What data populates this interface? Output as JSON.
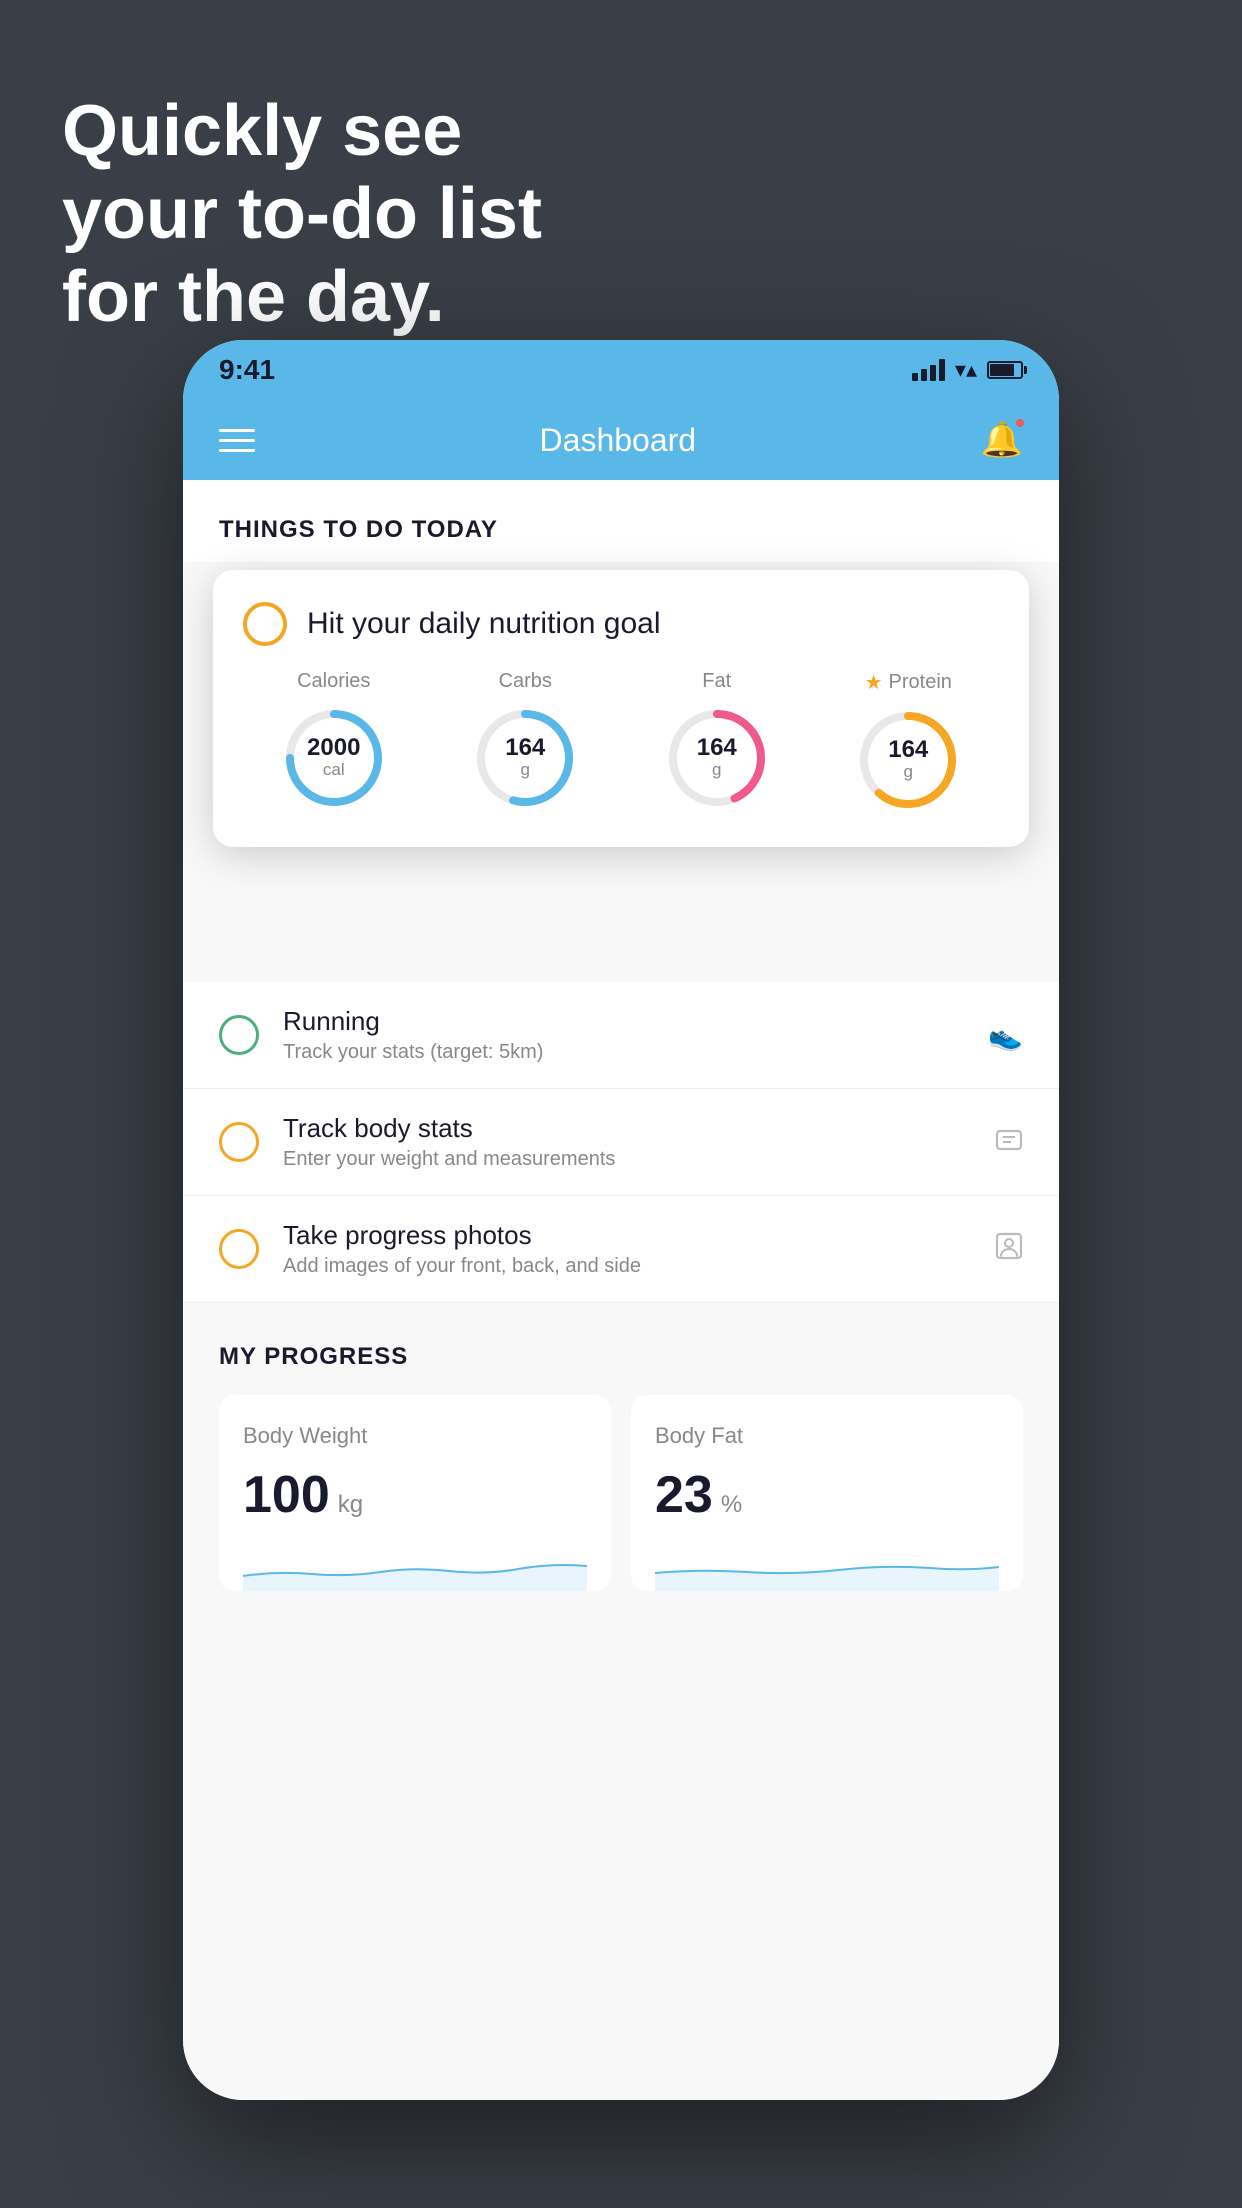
{
  "background": {
    "headline_line1": "Quickly see",
    "headline_line2": "your to-do list",
    "headline_line3": "for the day.",
    "bg_color": "#3a3f47"
  },
  "phone": {
    "status_bar": {
      "time": "9:41",
      "signal_bars": 4,
      "wifi": true,
      "battery_percent": 80
    },
    "nav_bar": {
      "title": "Dashboard",
      "menu_icon": "hamburger",
      "notification_icon": "bell",
      "has_notification": true
    },
    "things_to_do": {
      "section_title": "THINGS TO DO TODAY",
      "nutrition_card": {
        "title": "Hit your daily nutrition goal",
        "stats": [
          {
            "label": "Calories",
            "value": "2000",
            "unit": "cal",
            "color": "#5ab8e8",
            "starred": false
          },
          {
            "label": "Carbs",
            "value": "164",
            "unit": "g",
            "color": "#5ab8e8",
            "starred": false
          },
          {
            "label": "Fat",
            "value": "164",
            "unit": "g",
            "color": "#f05a8a",
            "starred": false
          },
          {
            "label": "Protein",
            "value": "164",
            "unit": "g",
            "color": "#f5a623",
            "starred": true
          }
        ]
      },
      "todo_items": [
        {
          "title": "Running",
          "subtitle": "Track your stats (target: 5km)",
          "circle_color": "green",
          "icon": "shoe"
        },
        {
          "title": "Track body stats",
          "subtitle": "Enter your weight and measurements",
          "circle_color": "yellow",
          "icon": "scale"
        },
        {
          "title": "Take progress photos",
          "subtitle": "Add images of your front, back, and side",
          "circle_color": "yellow",
          "icon": "portrait"
        }
      ]
    },
    "my_progress": {
      "section_title": "MY PROGRESS",
      "cards": [
        {
          "title": "Body Weight",
          "value": "100",
          "unit": "kg"
        },
        {
          "title": "Body Fat",
          "value": "23",
          "unit": "%"
        }
      ]
    }
  }
}
